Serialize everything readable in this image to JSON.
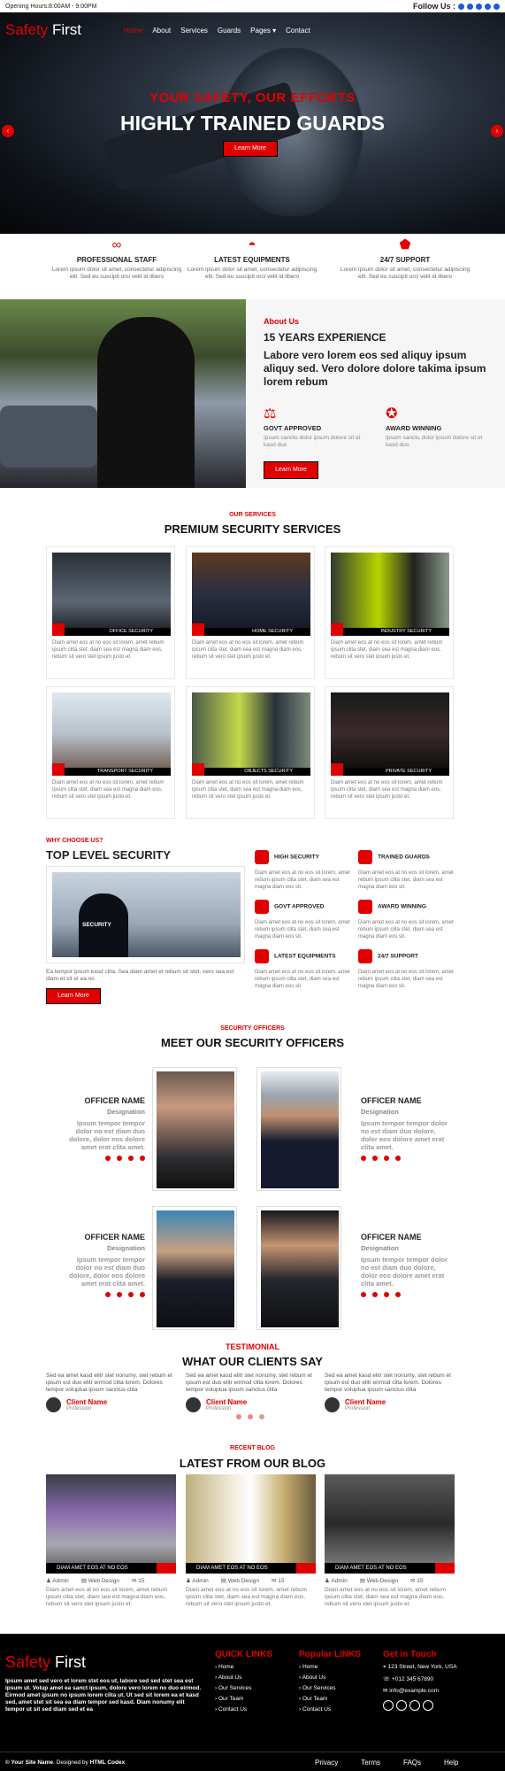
{
  "topbar": {
    "hours": "Opening Hours:8:00AM - 9:00PM",
    "follow": "Follow Us :"
  },
  "brand": {
    "safety": "Safety",
    "first": "First"
  },
  "nav": {
    "items": [
      "Home",
      "About",
      "Services",
      "Guards",
      "Pages",
      "Contact"
    ]
  },
  "hero": {
    "subtitle": "YOUR SAFETY, OUR EFFORTS",
    "title": "HIGHLY TRAINED GUARDS",
    "button": "Learn More",
    "prev": "‹",
    "next": "›"
  },
  "features": [
    {
      "title": "PROFESSIONAL STAFF",
      "text": "Lorem ipsum dolor sit amet, consectetur adipiscing elit. Sed eu suscipit orci velit id libero",
      "icon": "handcuffs-icon"
    },
    {
      "title": "LATEST EQUIPMENTS",
      "text": "Lorem ipsum dolor sit amet, consectetur adipiscing elit. Sed eu suscipit orci velit id libero",
      "icon": "helmet-icon"
    },
    {
      "title": "24/7 SUPPORT",
      "text": "Lorem ipsum dolor sit amet, consectetur adipiscing elit. Sed eu suscipit orci velit id libero",
      "icon": "shield-icon"
    }
  ],
  "about": {
    "sub": "About Us",
    "title": "15 YEARS EXPERIENCE",
    "lead": "Labore vero lorem eos sed aliquy ipsum aliquy sed. Vero dolore dolore takima ipsum lorem rebum",
    "items": [
      {
        "title": "GOVT APPROVED",
        "text": "Ipsum sanctu dolor ipsum dolore sit et kasd duo"
      },
      {
        "title": "AWARD WINNING",
        "text": "Ipsum sanctu dolor ipsum dolore sit et kasd duo"
      }
    ],
    "button": "Learn More"
  },
  "services": {
    "sub": "OUR SERVICES",
    "title": "PREMIUM SECURITY SERVICES",
    "text": "Diam amet eos at no eos sit lorem, amet rebum ipsum clita stet, diam sea est magna diam eos, rebum sit vero stet ipsum justo et.",
    "items": [
      "OFFICE SECURITY",
      "HOME SECURITY",
      "INDUSTRY SECURITY",
      "TRANSPORT SECURITY",
      "OBJECTS SECURITY",
      "PRIVATE SECURITY"
    ]
  },
  "why": {
    "sub": "WHY CHOOSE US?",
    "title": "TOP LEVEL SECURITY",
    "text": "Ea tempor ipsum kasd clita. Sea diam amet et rebum sit stet, vero sea est diam et sit et ea no",
    "button": "Learn More",
    "cardtext": "Diam amet eos at no eos sit lorem, amet rebum ipsum clita stet, diam sea est magna diam eos sit.",
    "items": [
      "HIGH SECURITY",
      "TRAINED GUARDS",
      "GOVT APPROVED",
      "AWARD WINNING",
      "LATEST EQUIPMENTS",
      "24/7 SUPPORT"
    ],
    "badge": "SECURITY"
  },
  "officers": {
    "sub": "SECURITY OFFICERS",
    "title": "MEET OUR SECURITY OFFICERS",
    "name": "OFFICER NAME",
    "designation": "Designation",
    "text": "Ipsum tempor tempor dolor no est diam duo dolore, dolor eos dolore amet erat clita amet."
  },
  "testimonial": {
    "sub": "TESTIMONIAL",
    "title": "WHAT OUR CLIENTS SAY",
    "text": "Sed ea amet kasd elitr stet nonumy, stet rebum et ipsum est duo elitr eirmod clita lorem. Dolores tempor voluptua ipsum sanctus clita",
    "name": "Client Name",
    "profession": "Profession"
  },
  "blog": {
    "sub": "RECENT BLOG",
    "title": "LATEST FROM OUR BLOG",
    "caption": "DIAM AMET EOS AT NO EOS",
    "author": "Admin",
    "category": "Web Design",
    "comments": "15",
    "text": "Diam amet eos at no eos sit lorem, amet rebum ipsum clita stet, diam sea est magna diam eos, rebum sit vero stet ipsum justo et."
  },
  "footer": {
    "about": "Ipsum amet sed vero et lorem stet eos ut, labore sed sed stet sea est ipsum ut. Volup amet ea sanct ipsum, dolore vero lorem no duo eirmod. Eirmod amet ipsum no ipsum lorem clita ut. Ut sed sit lorem ea et kasd sed, amet stet sit sea ea diam tempor sed kasd. Diam nonumy elit tempor ut sit sed diam sed et ea",
    "quick_title": "QUICK LINKS",
    "popular_title": "Popular LINKS",
    "contact_title": "Get in Touch",
    "links": [
      "Home",
      "About Us",
      "Our Services",
      "Our Team",
      "Contact Us"
    ],
    "address": "123 Street, New York, USA",
    "phone": "+012 345 67890",
    "email": "info@example.com",
    "copyright_a": "© Your Site Name",
    "copyright_b": ". Designed by ",
    "copyright_c": "HTML Codex",
    "bottom_links": [
      "Privacy",
      "Terms",
      "FAQs",
      "Help"
    ]
  }
}
